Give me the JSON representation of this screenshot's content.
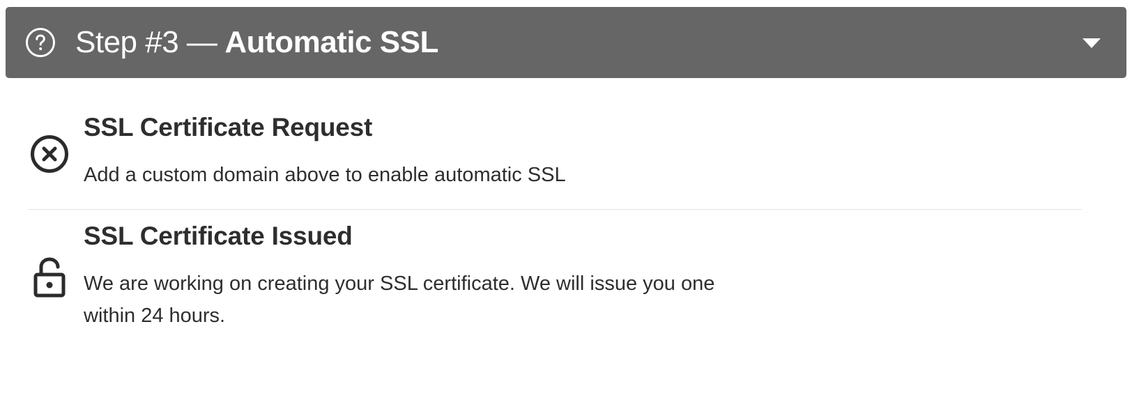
{
  "step": {
    "prefix": "Step #3 —",
    "title": "Automatic SSL",
    "help_icon": "question-circle-icon",
    "toggle_icon": "caret-down-icon"
  },
  "items": [
    {
      "icon": "x-circle-icon",
      "title": "SSL Certificate Request",
      "description": "Add a custom domain above to enable automatic SSL"
    },
    {
      "icon": "unlocked-padlock-icon",
      "title": "SSL Certificate Issued",
      "description": "We are working on creating your SSL certificate. We will issue you one within 24 hours."
    }
  ],
  "colors": {
    "header_bg": "#666666",
    "header_text": "#ffffff",
    "body_text": "#2e2e2e",
    "divider": "#e2e2e2"
  }
}
